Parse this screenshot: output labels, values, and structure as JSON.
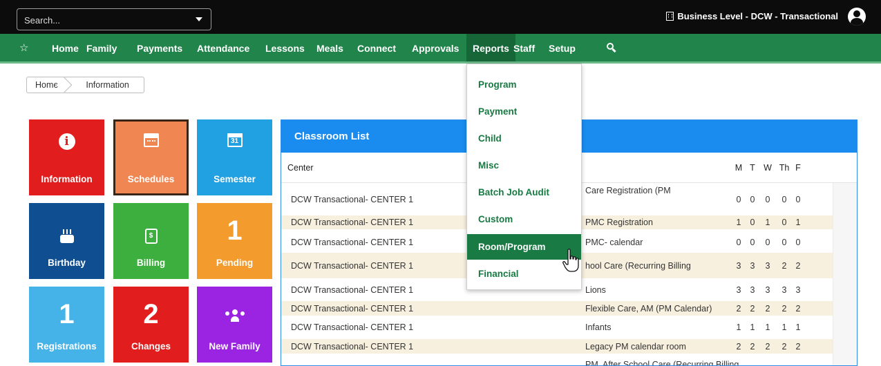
{
  "topbar": {
    "search_placeholder": "Search...",
    "business_label": "Business Level - DCW - Transactional"
  },
  "nav": {
    "items": [
      "Home",
      "Family",
      "Payments",
      "Attendance",
      "Lessons",
      "Meals",
      "Connect",
      "Approvals",
      "Reports",
      "Staff",
      "Setup"
    ],
    "active": "Reports"
  },
  "breadcrumb": [
    "Home",
    "Information"
  ],
  "tiles": {
    "information": "Information",
    "schedules": "Schedules",
    "semester": "Semester",
    "semester_day": "31",
    "birthday": "Birthday",
    "billing": "Billing",
    "pending": "Pending",
    "pending_count": "1",
    "registrations": "Registrations",
    "registrations_count": "1",
    "changes": "Changes",
    "changes_count": "2",
    "new_family": "New Family"
  },
  "classroom": {
    "title": "Classroom List",
    "columns": [
      "Center",
      "M",
      "T",
      "W",
      "Th",
      "F"
    ],
    "rows": [
      {
        "center": "DCW Transactional- CENTER 1",
        "room": "Care Registration (PM",
        "m": "0",
        "t": "0",
        "w": "0",
        "th": "0",
        "f": "0"
      },
      {
        "center": "DCW Transactional- CENTER 1",
        "room": "PMC Registration",
        "m": "1",
        "t": "0",
        "w": "1",
        "th": "0",
        "f": "1"
      },
      {
        "center": "DCW Transactional- CENTER 1",
        "room": "PMC- calendar",
        "m": "0",
        "t": "0",
        "w": "0",
        "th": "0",
        "f": "0"
      },
      {
        "center": "DCW Transactional- CENTER 1",
        "room": "hool Care (Recurring Billing",
        "m": "3",
        "t": "3",
        "w": "3",
        "th": "2",
        "f": "2"
      },
      {
        "center": "DCW Transactional- CENTER 1",
        "room": "Lions",
        "m": "3",
        "t": "3",
        "w": "3",
        "th": "3",
        "f": "3"
      },
      {
        "center": "DCW Transactional- CENTER 1",
        "room": "Flexible Care, AM (PM Calendar)",
        "m": "2",
        "t": "2",
        "w": "2",
        "th": "2",
        "f": "2"
      },
      {
        "center": "DCW Transactional- CENTER 1",
        "room": "Infants",
        "m": "1",
        "t": "1",
        "w": "1",
        "th": "1",
        "f": "1"
      },
      {
        "center": "DCW Transactional- CENTER 1",
        "room": "Legacy PM calendar room",
        "m": "2",
        "t": "2",
        "w": "2",
        "th": "2",
        "f": "2"
      },
      {
        "center": "",
        "room": "PM, After School Care (Recurring Billing",
        "m": "",
        "t": "",
        "w": "",
        "th": "",
        "f": ""
      }
    ]
  },
  "reports_menu": {
    "items": [
      "Program",
      "Payment",
      "Child",
      "Misc",
      "Batch Job Audit",
      "Custom",
      "Room/Program",
      "Financial"
    ],
    "highlighted": "Room/Program"
  },
  "colors": {
    "nav_green": "#21844b",
    "menu_text": "#177a42",
    "panel_blue": "#1a8cf0"
  }
}
